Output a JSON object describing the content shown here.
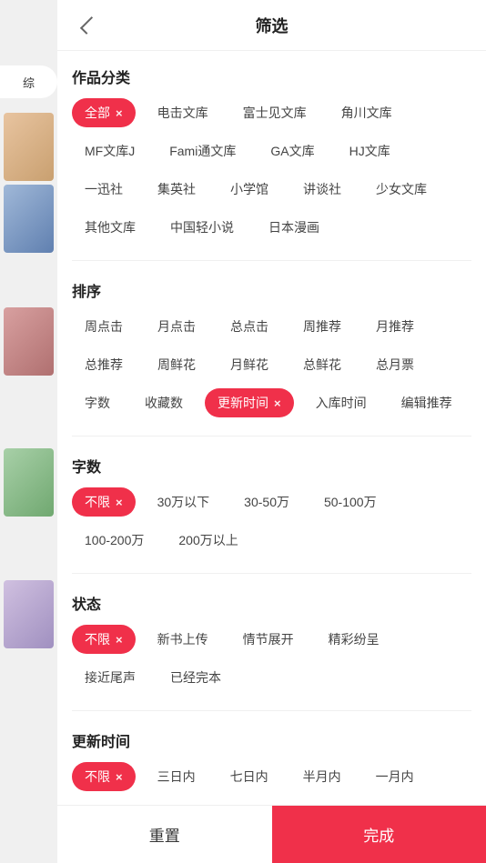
{
  "header": {
    "title": "筛选",
    "back_label": "back"
  },
  "sidebar": {
    "tab_label": "综"
  },
  "sections": {
    "category": {
      "title": "作品分类",
      "tags": [
        {
          "label": "全部",
          "active": true,
          "has_close": true
        },
        {
          "label": "电击文库",
          "active": false,
          "has_close": false
        },
        {
          "label": "富士见文库",
          "active": false,
          "has_close": false
        },
        {
          "label": "角川文库",
          "active": false,
          "has_close": false
        },
        {
          "label": "MF文库J",
          "active": false,
          "has_close": false
        },
        {
          "label": "Fami通文库",
          "active": false,
          "has_close": false
        },
        {
          "label": "GA文库",
          "active": false,
          "has_close": false
        },
        {
          "label": "HJ文库",
          "active": false,
          "has_close": false
        },
        {
          "label": "一迅社",
          "active": false,
          "has_close": false
        },
        {
          "label": "集英社",
          "active": false,
          "has_close": false
        },
        {
          "label": "小学馆",
          "active": false,
          "has_close": false
        },
        {
          "label": "讲谈社",
          "active": false,
          "has_close": false
        },
        {
          "label": "少女文库",
          "active": false,
          "has_close": false
        },
        {
          "label": "其他文库",
          "active": false,
          "has_close": false
        },
        {
          "label": "中国轻小说",
          "active": false,
          "has_close": false
        },
        {
          "label": "日本漫画",
          "active": false,
          "has_close": false
        }
      ]
    },
    "sort": {
      "title": "排序",
      "tags": [
        {
          "label": "周点击",
          "active": false,
          "has_close": false
        },
        {
          "label": "月点击",
          "active": false,
          "has_close": false
        },
        {
          "label": "总点击",
          "active": false,
          "has_close": false
        },
        {
          "label": "周推荐",
          "active": false,
          "has_close": false
        },
        {
          "label": "月推荐",
          "active": false,
          "has_close": false
        },
        {
          "label": "总推荐",
          "active": false,
          "has_close": false
        },
        {
          "label": "周鲜花",
          "active": false,
          "has_close": false
        },
        {
          "label": "月鲜花",
          "active": false,
          "has_close": false
        },
        {
          "label": "总鲜花",
          "active": false,
          "has_close": false
        },
        {
          "label": "总月票",
          "active": false,
          "has_close": false
        },
        {
          "label": "字数",
          "active": false,
          "has_close": false
        },
        {
          "label": "收藏数",
          "active": false,
          "has_close": false
        },
        {
          "label": "更新时间",
          "active": true,
          "has_close": true
        },
        {
          "label": "入库时间",
          "active": false,
          "has_close": false
        },
        {
          "label": "编辑推荐",
          "active": false,
          "has_close": false
        }
      ]
    },
    "wordcount": {
      "title": "字数",
      "tags": [
        {
          "label": "不限",
          "active": true,
          "has_close": true
        },
        {
          "label": "30万以下",
          "active": false,
          "has_close": false
        },
        {
          "label": "30-50万",
          "active": false,
          "has_close": false
        },
        {
          "label": "50-100万",
          "active": false,
          "has_close": false
        },
        {
          "label": "100-200万",
          "active": false,
          "has_close": false
        },
        {
          "label": "200万以上",
          "active": false,
          "has_close": false
        }
      ]
    },
    "status": {
      "title": "状态",
      "tags": [
        {
          "label": "不限",
          "active": true,
          "has_close": true
        },
        {
          "label": "新书上传",
          "active": false,
          "has_close": false
        },
        {
          "label": "情节展开",
          "active": false,
          "has_close": false
        },
        {
          "label": "精彩纷呈",
          "active": false,
          "has_close": false
        },
        {
          "label": "接近尾声",
          "active": false,
          "has_close": false
        },
        {
          "label": "已经完本",
          "active": false,
          "has_close": false
        }
      ]
    },
    "update_time": {
      "title": "更新时间",
      "tags": [
        {
          "label": "不限",
          "active": true,
          "has_close": true
        },
        {
          "label": "三日内",
          "active": false,
          "has_close": false
        },
        {
          "label": "七日内",
          "active": false,
          "has_close": false
        },
        {
          "label": "半月内",
          "active": false,
          "has_close": false
        },
        {
          "label": "一月内",
          "active": false,
          "has_close": false
        }
      ]
    }
  },
  "footer": {
    "reset_label": "重置",
    "confirm_label": "完成"
  },
  "colors": {
    "accent": "#f0304a",
    "text_primary": "#222",
    "text_secondary": "#444",
    "bg": "#fff"
  }
}
